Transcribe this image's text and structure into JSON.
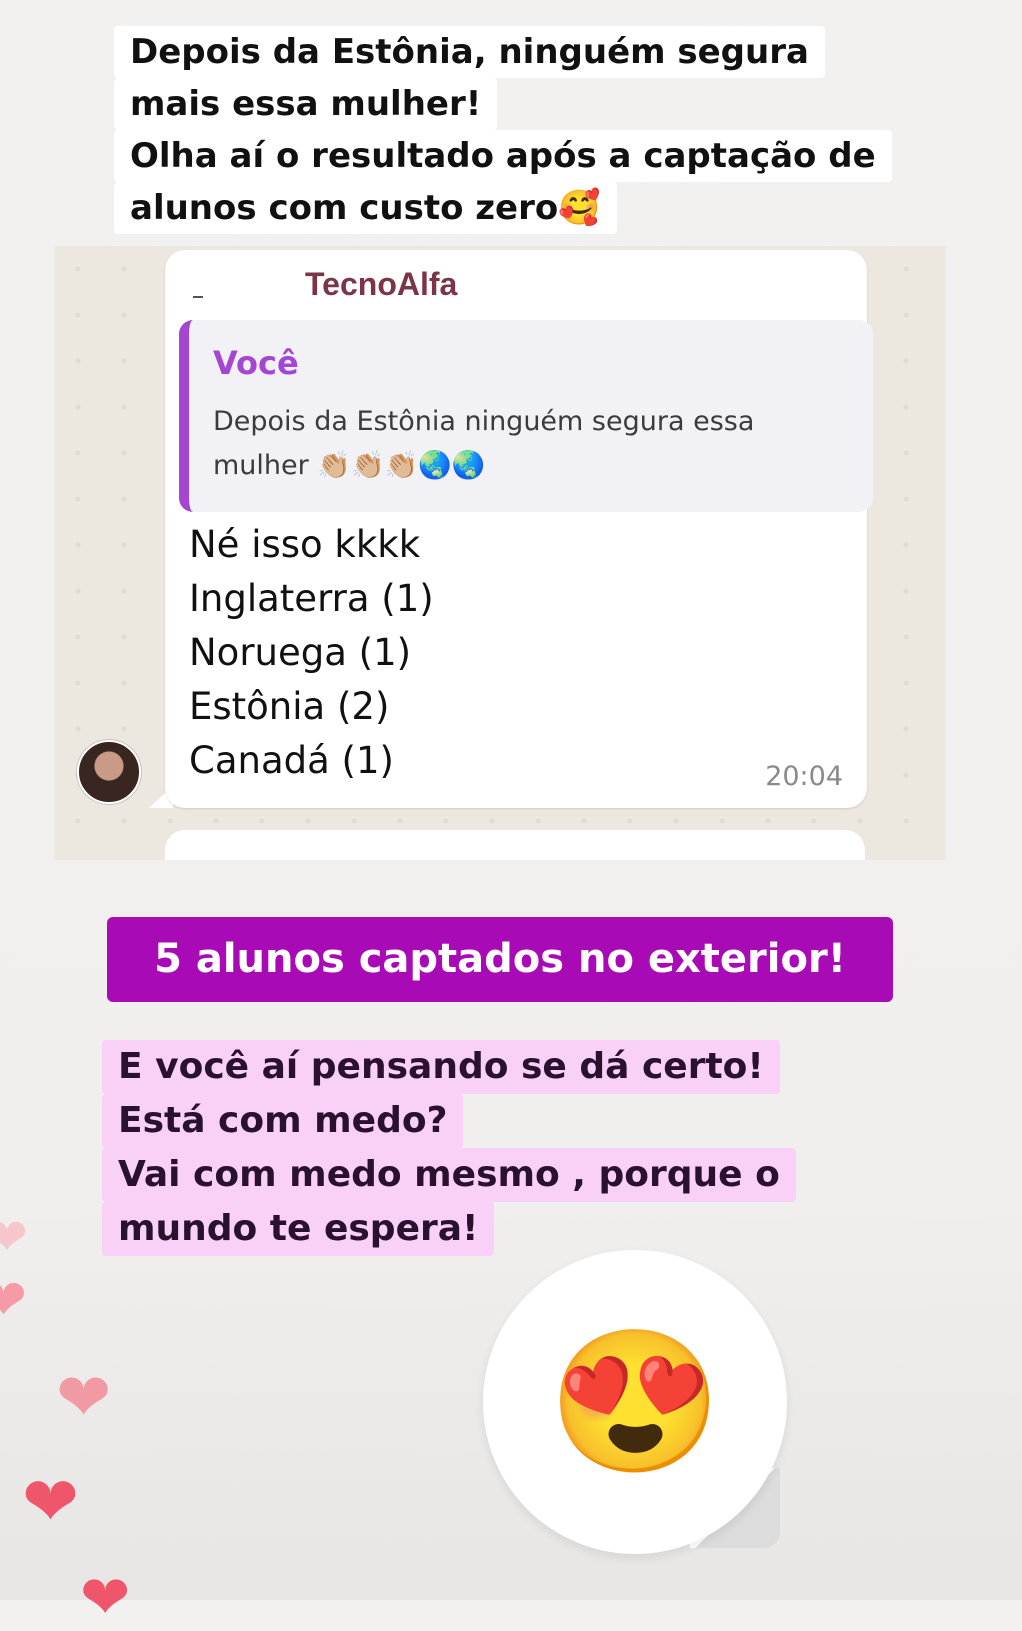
{
  "caption": {
    "lines": [
      "Depois da Estônia, ninguém segura",
      "mais essa mulher!",
      "Olha aí o resultado após a captação de",
      "alunos com custo zero🥰"
    ]
  },
  "chat": {
    "sender": "TecnoAlfa",
    "quote": {
      "author": "Você",
      "text": "Depois da Estônia ninguém segura essa mulher 👏🏼👏🏼👏🏼🌏🌏"
    },
    "message_lines": [
      "Né isso kkkk",
      "Inglaterra (1)",
      "Noruega (1)",
      "Estônia (2)",
      "Canadá (1)"
    ],
    "time": "20:04"
  },
  "highlight": "5 alunos captados no exterior!",
  "footer_lines": [
    "E você aí pensando se dá certo!",
    "Está com medo?",
    "Vai com medo mesmo , porque o",
    "mundo te espera!"
  ],
  "reaction": {
    "emoji": "😍"
  },
  "hearts": [
    "❤",
    "❤",
    "❤",
    "❤"
  ],
  "colors": {
    "sender": "#7b3547",
    "quote_accent": "#a545d4",
    "highlight_bg": "#a80ab5",
    "pink_bg": "#f8d0f8",
    "heart": "#f0566b"
  }
}
